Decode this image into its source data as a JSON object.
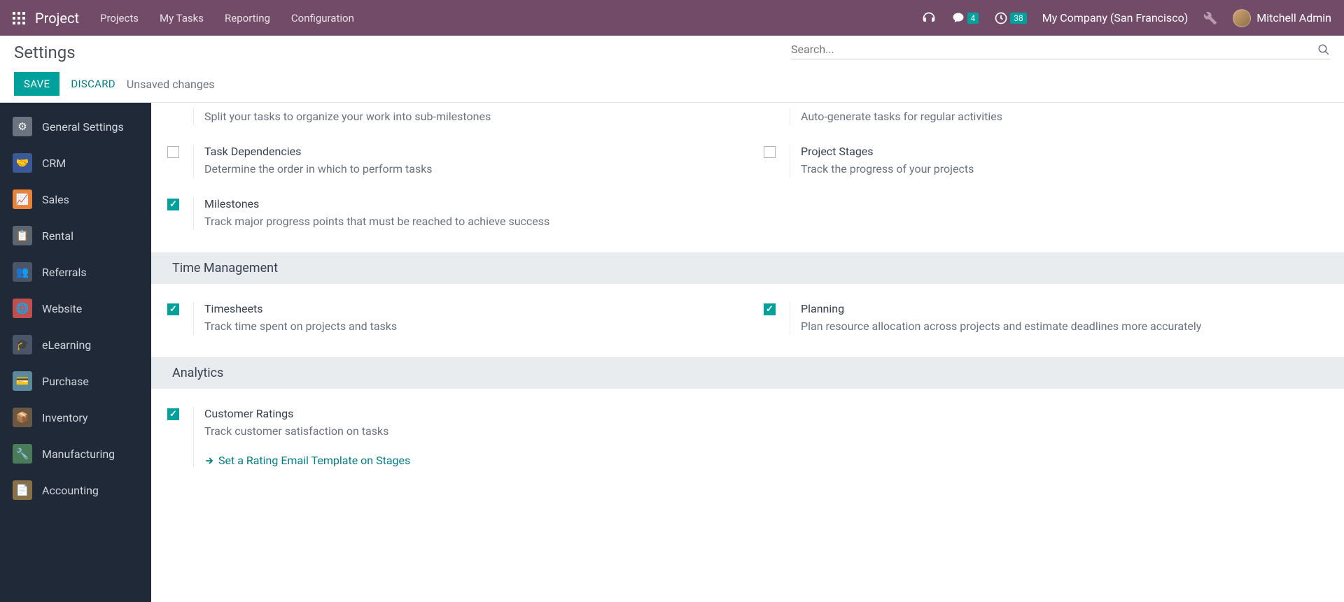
{
  "topnav": {
    "brand": "Project",
    "menu": [
      "Projects",
      "My Tasks",
      "Reporting",
      "Configuration"
    ],
    "messages_badge": "4",
    "activities_badge": "38",
    "company": "My Company (San Francisco)",
    "user": "Mitchell Admin"
  },
  "subhead": {
    "title": "Settings",
    "search_placeholder": "Search...",
    "save": "SAVE",
    "discard": "DISCARD",
    "unsaved": "Unsaved changes"
  },
  "sidebar": [
    {
      "label": "General Settings",
      "bg": "#6b7280"
    },
    {
      "label": "CRM",
      "bg": "#3b5998"
    },
    {
      "label": "Sales",
      "bg": "#e8833a"
    },
    {
      "label": "Rental",
      "bg": "#5b6770"
    },
    {
      "label": "Referrals",
      "bg": "#4a5568"
    },
    {
      "label": "Website",
      "bg": "#c0504d"
    },
    {
      "label": "eLearning",
      "bg": "#4a5568"
    },
    {
      "label": "Purchase",
      "bg": "#5b8a9f"
    },
    {
      "label": "Inventory",
      "bg": "#6b5844"
    },
    {
      "label": "Manufacturing",
      "bg": "#4a7c59"
    },
    {
      "label": "Accounting",
      "bg": "#8b6f47"
    }
  ],
  "settings": {
    "cutoff_left": {
      "checked": true,
      "desc": "Split your tasks to organize your work into sub-milestones"
    },
    "cutoff_right": {
      "desc": "Auto-generate tasks for regular activities"
    },
    "task_dep": {
      "checked": false,
      "name": "Task Dependencies",
      "desc": "Determine the order in which to perform tasks"
    },
    "proj_stages": {
      "checked": false,
      "name": "Project Stages",
      "desc": "Track the progress of your projects"
    },
    "milestones": {
      "checked": true,
      "name": "Milestones",
      "desc": "Track major progress points that must be reached to achieve success"
    },
    "section_time": "Time Management",
    "timesheets": {
      "checked": true,
      "name": "Timesheets",
      "desc": "Track time spent on projects and tasks"
    },
    "planning": {
      "checked": true,
      "name": "Planning",
      "desc": "Plan resource allocation across projects and estimate deadlines more accurately"
    },
    "section_analytics": "Analytics",
    "ratings": {
      "checked": true,
      "name": "Customer Ratings",
      "desc": "Track customer satisfaction on tasks",
      "link": "Set a Rating Email Template on Stages"
    }
  }
}
